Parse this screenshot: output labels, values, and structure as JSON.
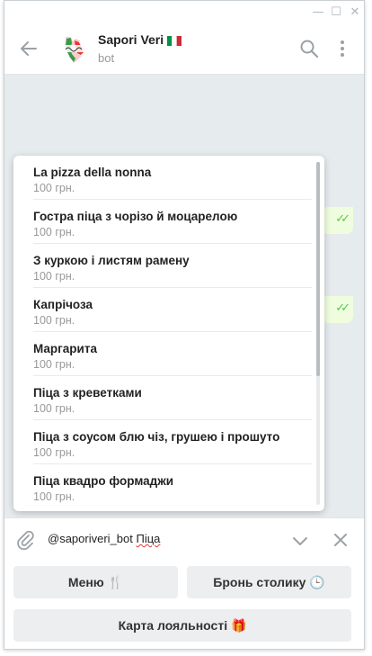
{
  "window": {
    "controls": {
      "minimize": "—",
      "maximize": "☐",
      "close": "✕"
    }
  },
  "header": {
    "title": "Sapori Veri",
    "subtitle": "bot",
    "title_flag_icon": "italy-flag-icon",
    "back_icon": "back-arrow-icon",
    "search_icon": "search-icon",
    "more_icon": "more-vertical-icon"
  },
  "chat": {
    "bubbles": [
      {
        "status": "✓✓"
      },
      {
        "status": "✓✓"
      }
    ]
  },
  "results": {
    "items": [
      {
        "title": "La pizza della nonna",
        "price": "100 грн."
      },
      {
        "title": "Гостра піца з чорізо й моцарелою",
        "price": "100 грн."
      },
      {
        "title": "З куркою і листям рамену",
        "price": "100 грн."
      },
      {
        "title": "Капрічоза",
        "price": "100 грн."
      },
      {
        "title": "Маргарита",
        "price": "100 грн."
      },
      {
        "title": "Піца з креветками",
        "price": "100 грн."
      },
      {
        "title": "Піца з соусом блю чіз, грушею і прошуто",
        "price": "100 грн."
      },
      {
        "title": "Піца квадро формаджи",
        "price": "100 грн."
      }
    ]
  },
  "input": {
    "bot_mention": "@saporiveri_bot",
    "query": "Піца"
  },
  "keyboard": {
    "menu": "Меню 🍴",
    "booking": "Бронь столику 🕒",
    "loyalty": "Карта лояльності 🎁"
  },
  "colors": {
    "accent_green": "#5dc452",
    "bubble_bg": "#effdde",
    "chat_bg": "#e6ebee"
  }
}
